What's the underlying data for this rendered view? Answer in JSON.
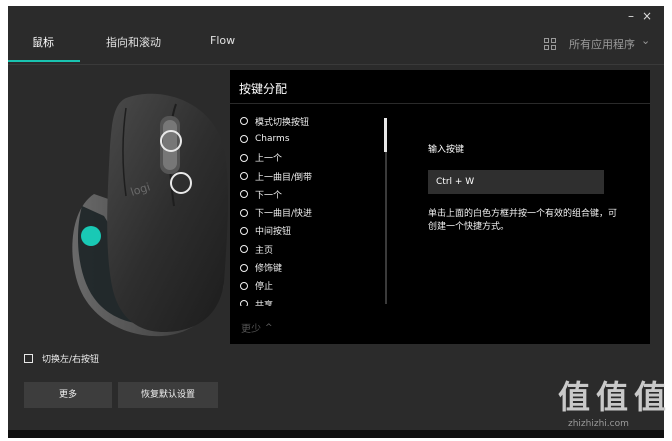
{
  "window": {
    "minimize_glyph": "–",
    "close_glyph": "×"
  },
  "tabs": [
    {
      "label": "鼠标",
      "active": true
    },
    {
      "label": "指向和滚动",
      "active": false
    },
    {
      "label": "Flow",
      "active": false
    }
  ],
  "app_selector": {
    "label": "所有应用程序",
    "icon": "grid-icon",
    "chevron": "⌄"
  },
  "panel": {
    "title": "按键分配",
    "actions": [
      "模式切换按钮",
      "Charms",
      "上一个",
      "上一曲目/倒带",
      "下一个",
      "下一曲目/快进",
      "中间按钮",
      "主页",
      "修饰键",
      "停止",
      "共享"
    ],
    "less_link": "更少",
    "input_label": "输入按键",
    "input_value": "Ctrl + W",
    "help_text": "单击上面的白色方框并按一个有效的组合键，可创建一个快捷方式。"
  },
  "mouse": {
    "brand_text": "logi",
    "hotspot_colors": {
      "ring": "#e9e9e9",
      "active": "#19c9b5"
    }
  },
  "footer": {
    "swap_buttons_label": "切换左/右按钮",
    "more_button": "更多",
    "restore_button": "恢复默认设置"
  },
  "watermark": {
    "chars": [
      "值",
      "值",
      "值"
    ],
    "url": "zhizhizhi.com"
  },
  "colors": {
    "accent": "#19c3b0",
    "background": "#2b2b2b",
    "panel": "#000000"
  }
}
